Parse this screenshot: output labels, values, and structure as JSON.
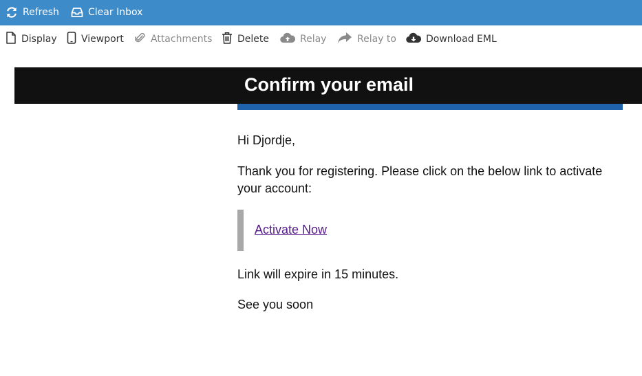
{
  "topbar": {
    "refresh_label": "Refresh",
    "clear_inbox_label": "Clear Inbox",
    "background": "#3d8bc9"
  },
  "toolbar": {
    "display_label": "Display",
    "viewport_label": "Viewport",
    "attachments_label": "Attachments",
    "delete_label": "Delete",
    "relay_label": "Relay",
    "relay_to_label": "Relay to",
    "download_eml_label": "Download EML",
    "attachments_enabled": false,
    "relay_enabled": false,
    "relay_to_enabled": false
  },
  "email": {
    "title": "Confirm your email",
    "greeting": "Hi Djordje,",
    "intro": "Thank you for registering. Please click on the below link to activate your account:",
    "link_text": "Activate Now",
    "expiry": "Link will expire in 15 minutes.",
    "signoff": "See you soon",
    "header_color": "#111111",
    "accent_color": "#1f63ad",
    "link_color": "#551a8b"
  }
}
